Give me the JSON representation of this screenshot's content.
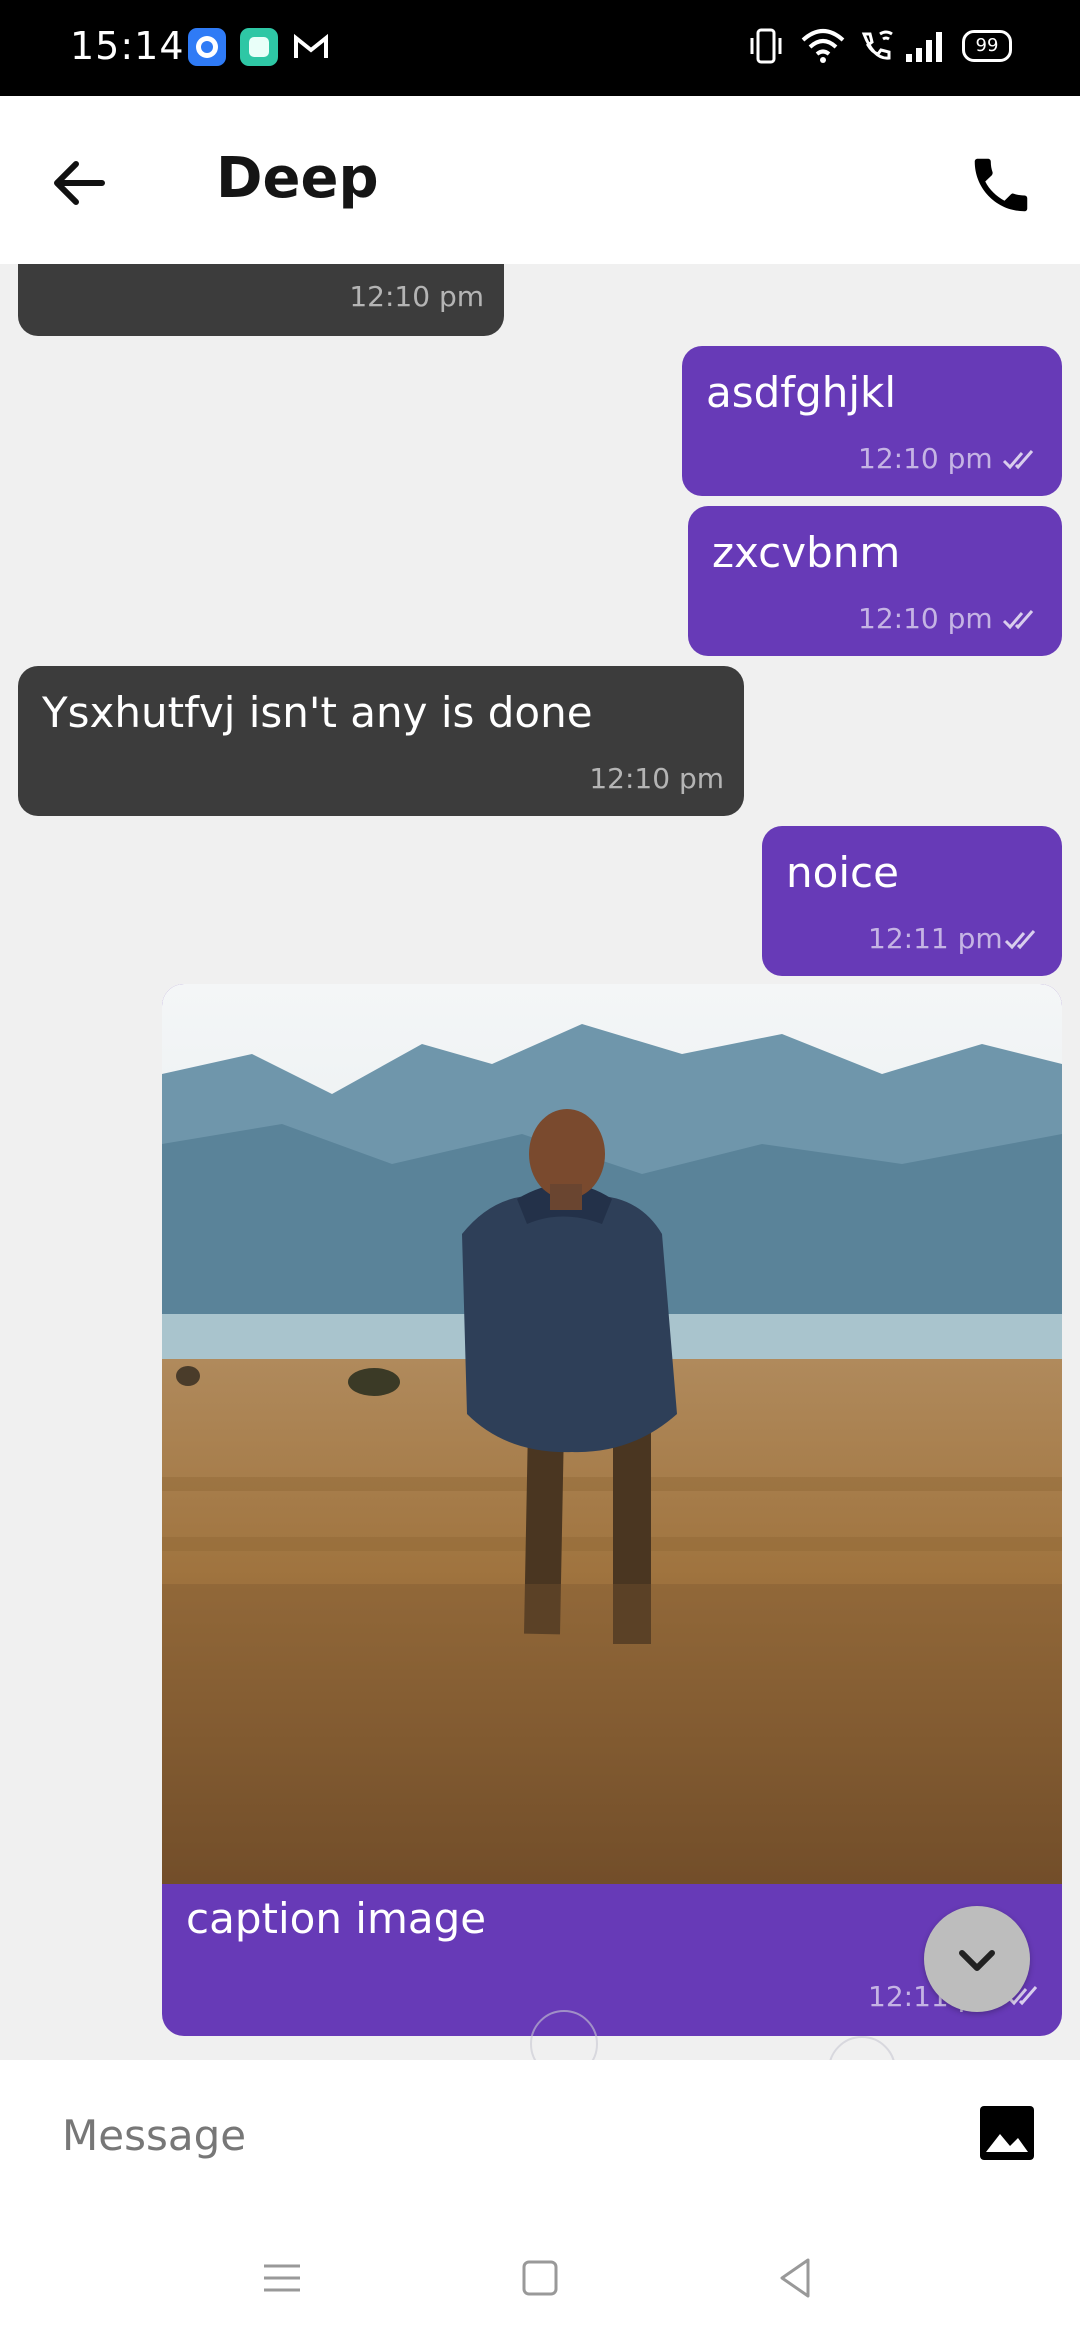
{
  "status_bar": {
    "time": "15:14",
    "battery": "99",
    "notification_icons": [
      "browser-app-icon",
      "gallery-app-icon",
      "gmail-icon"
    ],
    "system_icons": [
      "vibrate-icon",
      "wifi-icon",
      "wifi-call-icon",
      "signal-icon",
      "battery-icon"
    ]
  },
  "header": {
    "title": "Deep",
    "back_icon": "arrow-back-icon",
    "call_icon": "phone-icon"
  },
  "messages": [
    {
      "direction": "incoming",
      "text": "",
      "time": "12:10 pm"
    },
    {
      "direction": "outgoing",
      "text": "asdfghjkl",
      "time": "12:10 pm",
      "read": true
    },
    {
      "direction": "outgoing",
      "text": "zxcvbnm",
      "time": "12:10 pm",
      "read": true
    },
    {
      "direction": "incoming",
      "text": "Ysxhutfvj isn't any is done",
      "time": "12:10 pm"
    },
    {
      "direction": "outgoing",
      "text": "noice",
      "time": "12:11 pm",
      "read": true
    }
  ],
  "image_message": {
    "direction": "outgoing",
    "caption": "caption image",
    "time": "12:11 pm",
    "read": true
  },
  "scroll_down_icon": "chevron-down-icon",
  "composer": {
    "placeholder": "Message",
    "gallery_icon": "image-icon"
  },
  "nav_bar": {
    "icons": [
      "menu-icon",
      "home-icon",
      "back-triangle-icon"
    ]
  },
  "colors": {
    "outgoing_bubble": "#673ab7",
    "incoming_bubble": "#3c3c3c",
    "chat_background": "#f0f0f0"
  }
}
